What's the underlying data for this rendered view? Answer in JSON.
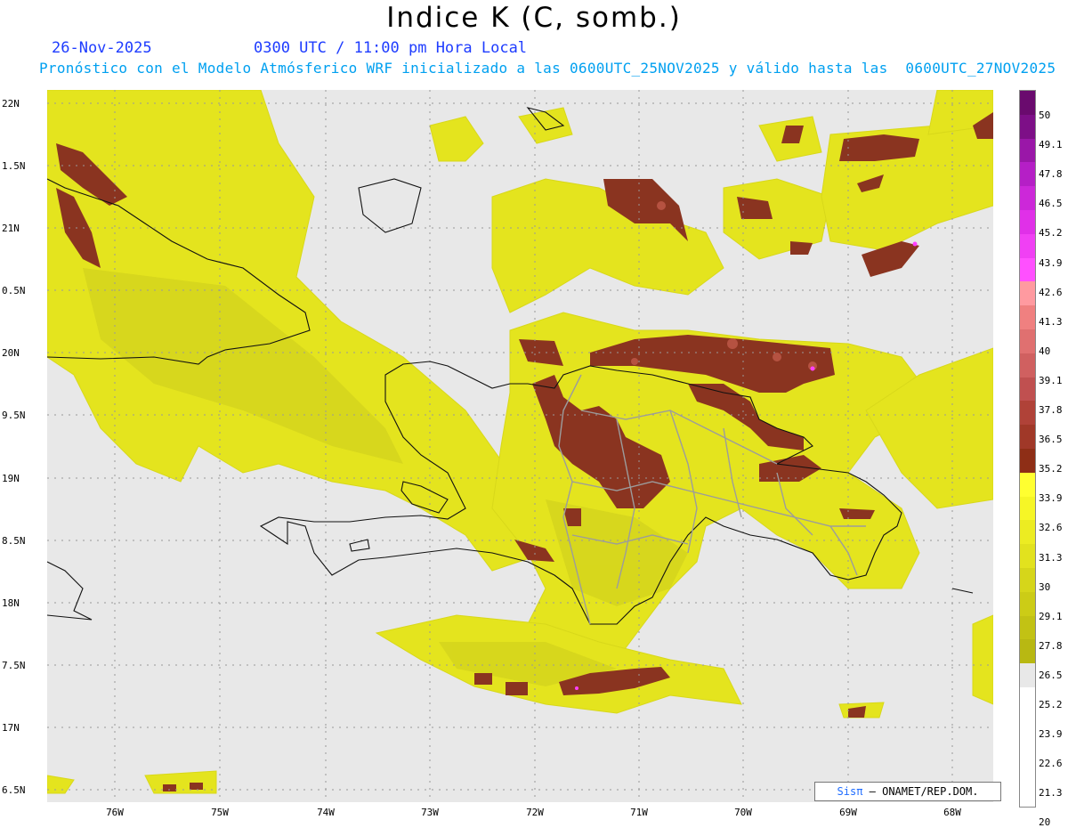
{
  "title": "Indice K (C, somb.)",
  "date": "26-Nov-2025",
  "time": "0300 UTC / 11:00 pm Hora Local",
  "forecast_line": "Pronóstico con el Modelo Atmósferico WRF inicializado a las 0600UTC_25NOV2025 y válido hasta las  0600UTC_27NOV2025",
  "lat_labels": [
    "22N",
    "1.5N",
    "21N",
    "0.5N",
    "20N",
    "9.5N",
    "19N",
    "8.5N",
    "18N",
    "7.5N",
    "17N",
    "6.5N"
  ],
  "lon_labels": [
    "76W",
    "75W",
    "74W",
    "73W",
    "72W",
    "71W",
    "70W",
    "69W",
    "68W"
  ],
  "colorbar": {
    "labels": [
      "50",
      "49.1",
      "47.8",
      "46.5",
      "45.2",
      "43.9",
      "42.6",
      "41.3",
      "40",
      "39.1",
      "37.8",
      "36.5",
      "35.2",
      "33.9",
      "32.6",
      "31.3",
      "30",
      "29.1",
      "27.8",
      "26.5",
      "25.2",
      "23.9",
      "22.6",
      "21.3",
      "20"
    ],
    "colors": [
      "#6a0a6e",
      "#7d0f87",
      "#9a17a8",
      "#b51fc6",
      "#cc28d9",
      "#e030e8",
      "#f040f4",
      "#ff50ff",
      "#ff9aa0",
      "#f08080",
      "#e07070",
      "#d06060",
      "#c05050",
      "#b04238",
      "#a03828",
      "#8e2e16",
      "#ffff30",
      "#f6f626",
      "#ecec22",
      "#e2e21e",
      "#d6d61a",
      "#cccc16",
      "#c2c214",
      "#b8b812",
      "#e8e8e8"
    ]
  },
  "credit": {
    "sis": "Sisπ",
    "org": "– ONAMET/REP.DOM."
  },
  "colors": {
    "sea": "#e8e8e8",
    "low": "#e8e820",
    "mid": "#c8c820",
    "high": "#8a3420",
    "extreme": "#ff40ff"
  }
}
